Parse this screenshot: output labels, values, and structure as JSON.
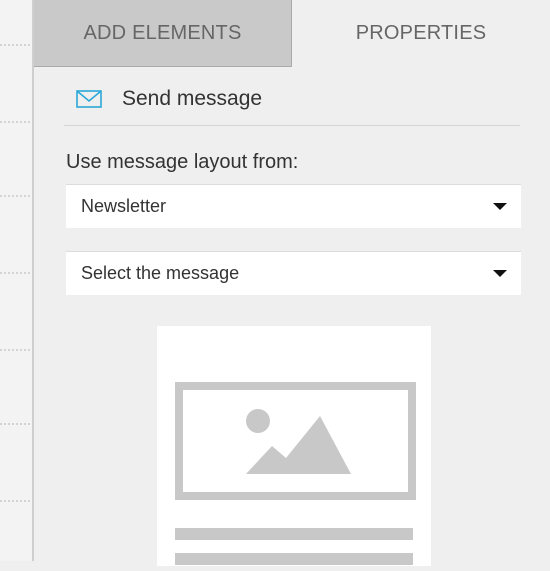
{
  "tabs": {
    "add_elements": "ADD ELEMENTS",
    "properties": "PROPERTIES",
    "active": "properties"
  },
  "element": {
    "icon": "envelope-icon",
    "title": "Send message"
  },
  "layout_field": {
    "label": "Use message layout from:",
    "selected": "Newsletter"
  },
  "message_field": {
    "selected": "Select the message"
  },
  "preview": {
    "icon": "image-placeholder-icon"
  },
  "colors": {
    "accent": "#2aa8d8",
    "panel_bg": "#efefef",
    "inactive_tab": "#c9c9c9",
    "placeholder_gray": "#c8c8c8"
  }
}
